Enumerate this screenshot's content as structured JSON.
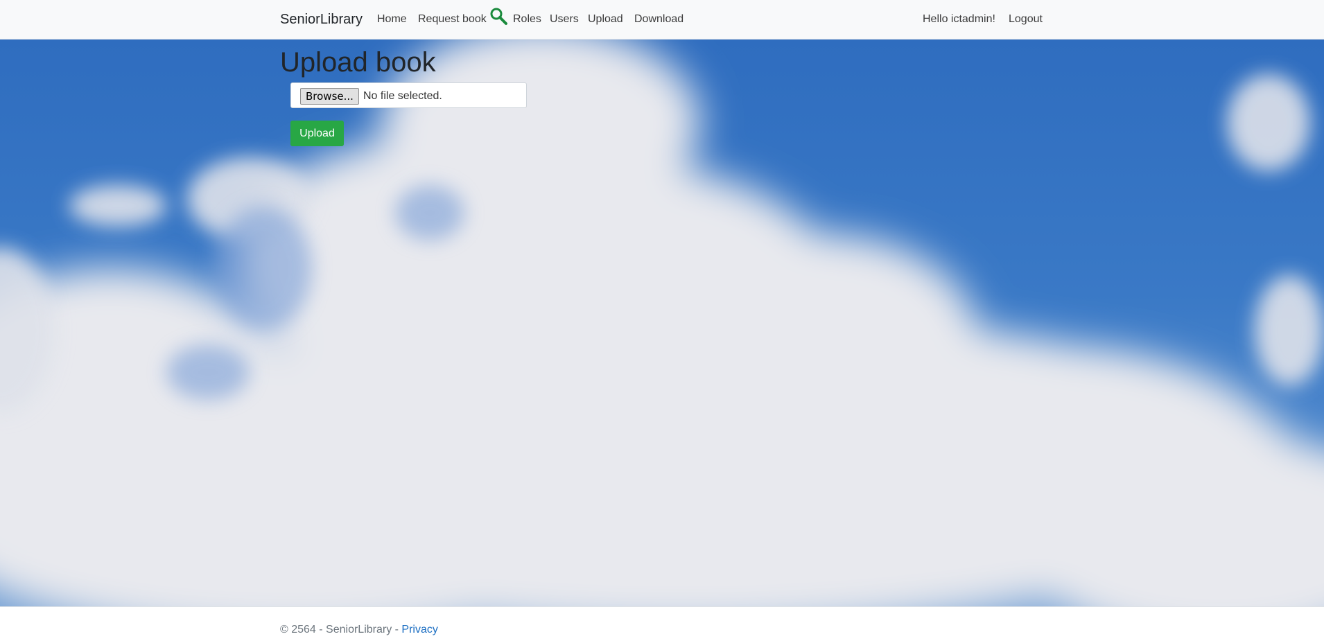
{
  "navbar": {
    "brand": "SeniorLibrary",
    "items": [
      {
        "label": "Home"
      },
      {
        "label": "Request book"
      },
      {
        "label": "Roles"
      },
      {
        "label": "Users"
      },
      {
        "label": "Upload"
      },
      {
        "label": "Download"
      }
    ],
    "search_icon": "search-icon",
    "greeting": "Hello ictadmin!",
    "logout": "Logout"
  },
  "main": {
    "title": "Upload book",
    "file_input": {
      "browse_label": "Browse...",
      "status": "No file selected."
    },
    "upload_button": "Upload"
  },
  "footer": {
    "text": "© 2564 - SeniorLibrary - ",
    "privacy_link": "Privacy"
  },
  "colors": {
    "navbar_bg": "#f8f9fa",
    "sky_blue": "#2f6dbf",
    "upload_button": "#28a745",
    "link": "#1b6ec2",
    "search_icon": "#1a8a3c"
  }
}
